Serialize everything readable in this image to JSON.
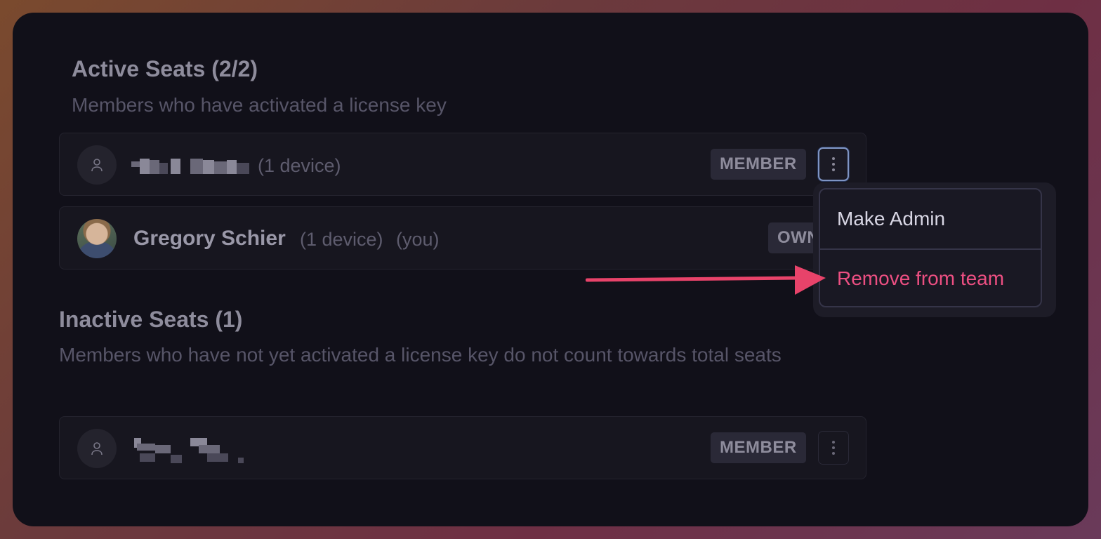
{
  "active": {
    "title": "Active Seats (2/2)",
    "description": "Members who have activated a license key",
    "rows": [
      {
        "name": "",
        "meta": "(1 device)",
        "badge": "MEMBER",
        "avatar": "user-icon"
      },
      {
        "name": "Gregory Schier",
        "meta": "(1 device)",
        "you": "(you)",
        "badge": "OWNER",
        "avatar": "photo"
      }
    ]
  },
  "inactive": {
    "title": "Inactive Seats (1)",
    "description": "Members who have not yet activated a license key do not count towards total seats",
    "rows": [
      {
        "name": "",
        "badge": "MEMBER",
        "avatar": "user-icon"
      }
    ]
  },
  "menu": {
    "items": [
      {
        "label": "Make Admin",
        "color": "#d8d6e4"
      },
      {
        "label": "Remove from team",
        "color": "#ec4f82"
      }
    ]
  },
  "colors": {
    "arrow": "#e8436a",
    "danger": "#ec4f82"
  }
}
